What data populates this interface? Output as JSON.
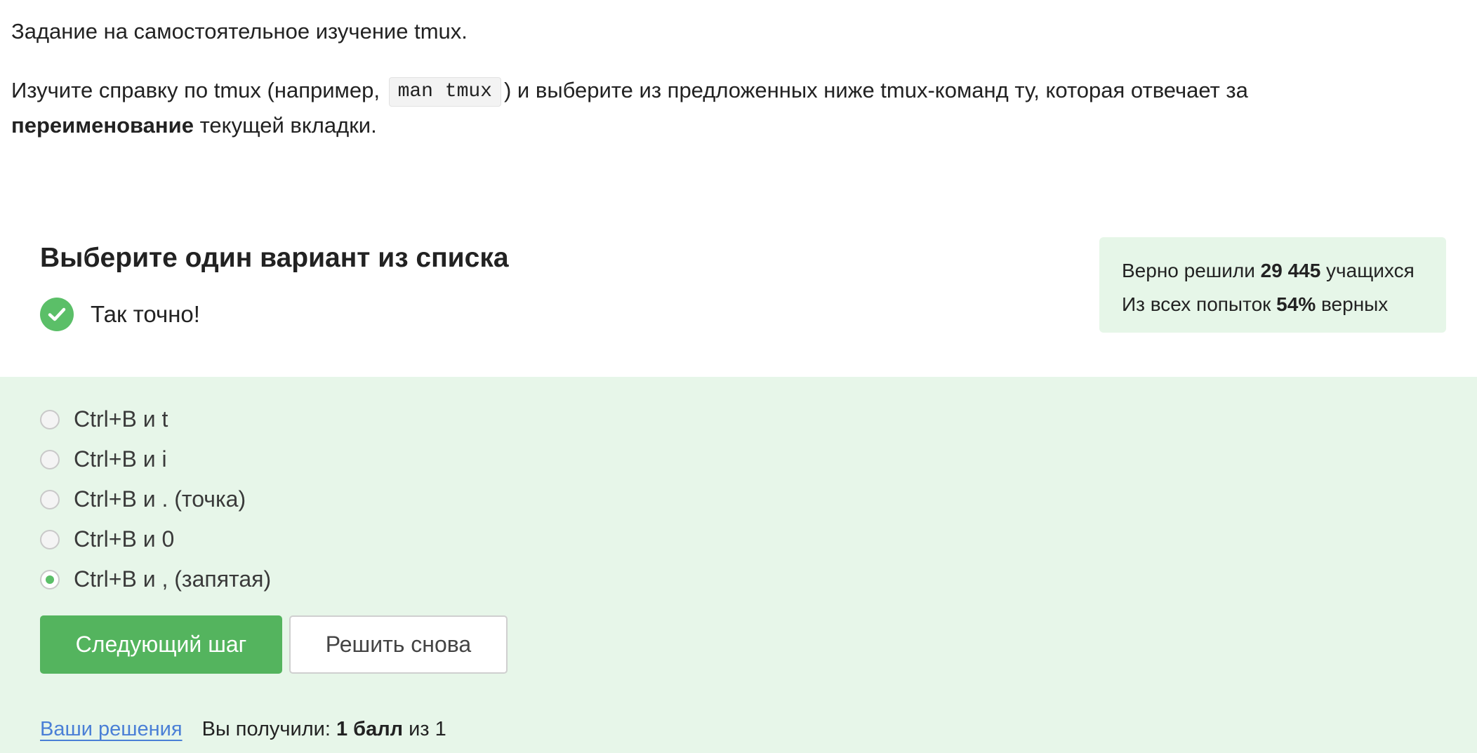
{
  "task": {
    "line1": "Задание на самостоятельное изучение tmux.",
    "p2_before": "Изучите справку по tmux (например, ",
    "code": "man tmux",
    "p2_after": ") и выберите из предложенных ниже tmux-команд ту, которая отвечает за",
    "bold_word": "переименование",
    "p2_end": " текущей вкладки."
  },
  "quiz": {
    "title": "Выберите один вариант из списка",
    "feedback": "Так точно!"
  },
  "stats": {
    "line1_prefix": "Верно решили ",
    "line1_count": "29 445",
    "line1_suffix": " учащихся",
    "line2_prefix": "Из всех попыток ",
    "line2_percent": "54%",
    "line2_suffix": " верных"
  },
  "options": [
    {
      "label": "Ctrl+B и t",
      "selected": false
    },
    {
      "label": "Ctrl+B и i",
      "selected": false
    },
    {
      "label": "Ctrl+B и . (точка)",
      "selected": false
    },
    {
      "label": "Ctrl+B и 0",
      "selected": false
    },
    {
      "label": "Ctrl+B и , (запятая)",
      "selected": true
    }
  ],
  "buttons": {
    "next": "Следующий шаг",
    "retry": "Решить снова"
  },
  "footer": {
    "link": "Ваши решения",
    "score_prefix": "Вы получили: ",
    "score_value": "1 балл",
    "score_suffix": " из 1"
  },
  "colors": {
    "accent_green": "#54b45e",
    "answer_bg": "#e7f6e9",
    "link_blue": "#4a7fd6"
  }
}
